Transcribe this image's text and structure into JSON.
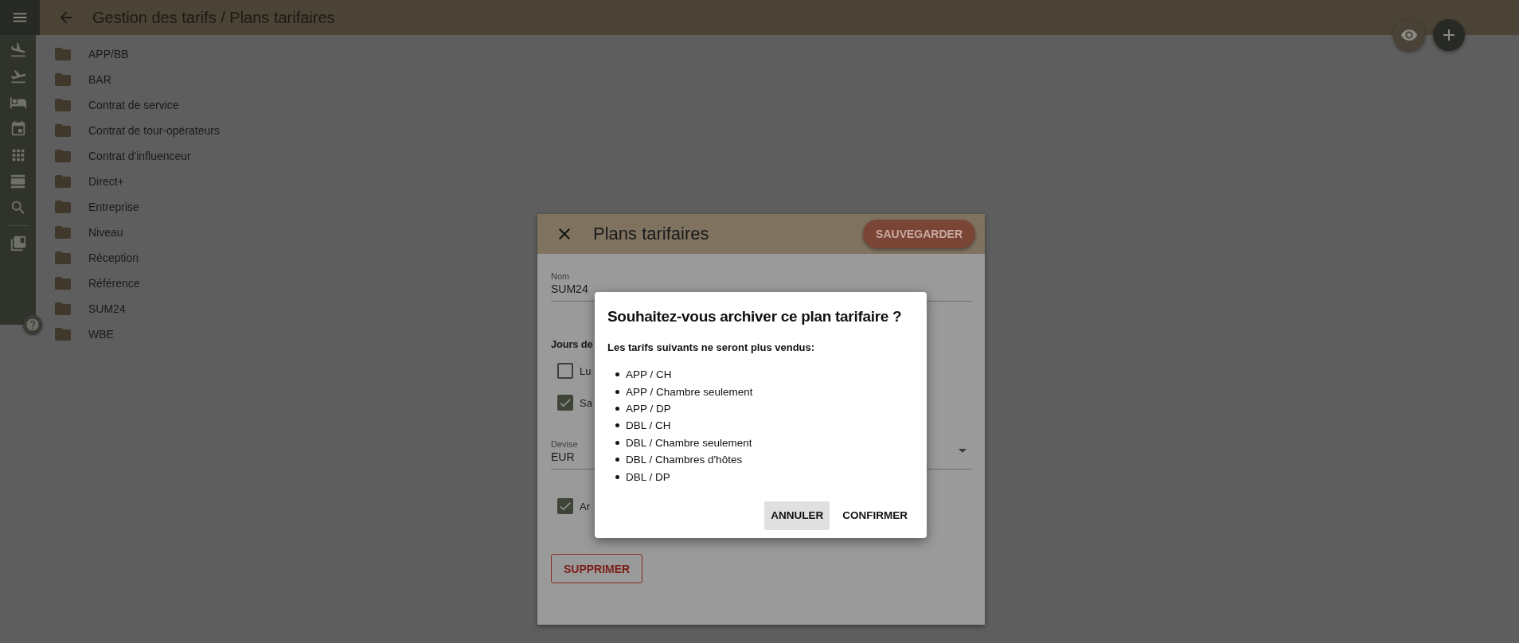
{
  "topbar": {
    "title": "Gestion des tarifs / Plans tarifaires"
  },
  "folders": [
    "APP/BB",
    "BAR",
    "Contrat de service",
    "Contrat de tour-opérateurs",
    "Contrat d'influenceur",
    "Direct+",
    "Entreprise",
    "Niveau",
    "Réception",
    "Référence",
    "SUM24",
    "WBE"
  ],
  "drawer": {
    "title": "Plans tarifaires",
    "save": "SAUVEGARDER",
    "name_field": {
      "label": "Nom",
      "value": "SUM24"
    },
    "days_heading": "Jours de",
    "days": [
      {
        "label": "Lu",
        "checked": false
      },
      {
        "label": "Sa",
        "checked": true
      }
    ],
    "currency_field": {
      "label": "Devise",
      "value": "EUR"
    },
    "archive": {
      "label": "Ar",
      "checked": true
    },
    "delete": "SUPPRIMER"
  },
  "confirm": {
    "title": "Souhaitez-vous archiver ce plan tarifaire ?",
    "intro": "Les tarifs suivants ne seront plus vendus:",
    "items": [
      "APP / CH",
      "APP / Chambre seulement",
      "APP / DP",
      "DBL / CH",
      "DBL / Chambre seulement",
      "DBL / Chambres d'hôtes",
      "DBL / DP"
    ],
    "buttons": [
      {
        "label": "ANNULER",
        "selected": true
      },
      {
        "label": "CONFIRMER",
        "selected": false
      }
    ]
  }
}
